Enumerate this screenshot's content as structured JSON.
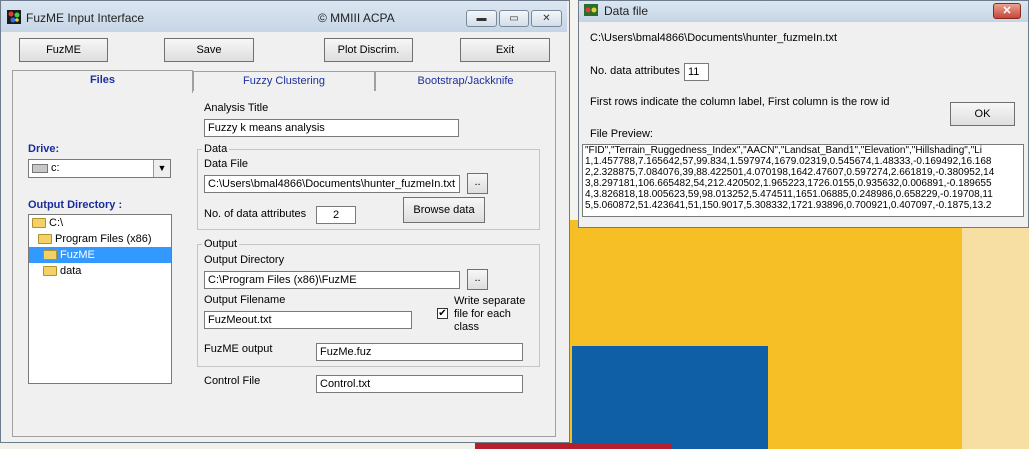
{
  "main_window": {
    "title": "FuzME  Input Interface",
    "copyright": "© MMIII ACPA",
    "toolbar": {
      "fuzme_label": "FuzME",
      "save_label": "Save",
      "plot_label": "Plot Discrim.",
      "exit_label": "Exit"
    },
    "tabs": [
      {
        "label": "Files"
      },
      {
        "label": "Fuzzy Clustering"
      },
      {
        "label": "Bootstrap/Jackknife"
      }
    ],
    "drive": {
      "label": "Drive:",
      "value": "c:"
    },
    "output_directory": {
      "label": "Output Directory :",
      "tree": [
        "C:\\",
        "Program Files (x86)",
        "FuzME",
        "data"
      ]
    },
    "analysis_title": {
      "label": "Analysis Title",
      "value": "Fuzzy k means analysis"
    },
    "data_group": {
      "title": "Data",
      "file_label": "Data File",
      "file_value": "C:\\Users\\bmal4866\\Documents\\hunter_fuzmeIn.txt",
      "browse_small": "..",
      "attrs_label": "No. of data attributes",
      "attrs_value": "2",
      "browse_label": "Browse data"
    },
    "output_group": {
      "title": "Output",
      "dir_label": "Output Directory",
      "dir_value": "C:\\Program Files (x86)\\FuzME",
      "browse_small": "..",
      "filename_label": "Output Filename",
      "filename_value": "FuzMeout.txt",
      "separate_label": "Write separate file for each class",
      "fuzme_output_label": "FuzME output",
      "fuzme_output_value": "FuzMe.fuz"
    },
    "control_file": {
      "label": "Control File",
      "value": "Control.txt"
    }
  },
  "data_window": {
    "title": "Data file",
    "path": "C:\\Users\\bmal4866\\Documents\\hunter_fuzmeIn.txt",
    "attrs_label": "No. data attributes",
    "attrs_value": "11",
    "info": "First rows indicate the column label, First column is the row id",
    "ok_label": "OK",
    "preview_label": "File Preview:",
    "preview_lines": [
      "\"FID\",\"Terrain_Ruggedness_Index\",\"AACN\",\"Landsat_Band1\",\"Elevation\",\"Hillshading\",\"Li",
      "1,1.457788,7.165642,57,99.834,1.597974,1679.02319,0.545674,1.48333,-0.169492,16.168",
      "2,2.328875,7.084076,39,88.422501,4.070198,1642.47607,0.597274,2.661819,-0.380952,14",
      "3,8.297181,106.665482,54,212.420502,1.965223,1726.0155,0.935632,0.006891,-0.189655",
      "4,3.826818,18.005623,59,98.013252,5.474511,1651.06885,0.248986,0.658229,-0.19708,11",
      "5,5.060872,51.423641,51,150.9017,5.308332,1721.93896,0.700921,0.407097,-0.1875,13.2"
    ]
  }
}
